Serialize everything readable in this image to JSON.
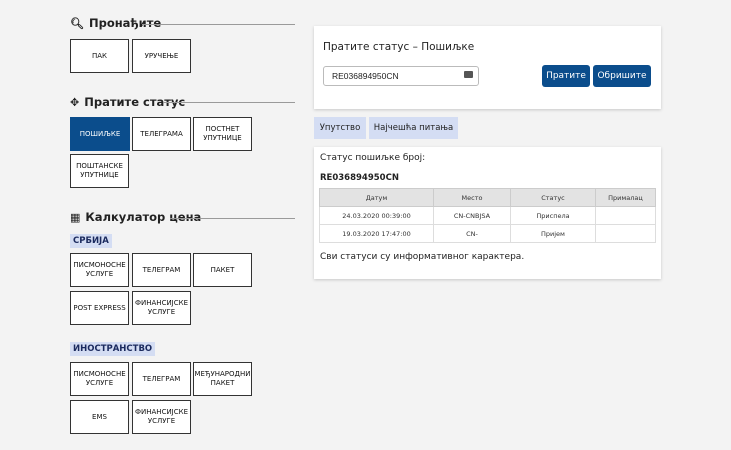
{
  "find": {
    "title": "Пронађите",
    "items": [
      "ПАК",
      "УРУЧЕЊЕ"
    ]
  },
  "status": {
    "title": "Пратите статус",
    "items": [
      "ПОШИЉКЕ",
      "ТЕЛЕГРАМА",
      "ПОСТНЕТ УПУТНИЦЕ",
      "ПОШТАНСКЕ УПУТНИЦЕ"
    ]
  },
  "calc": {
    "title": "Калкулатор цена",
    "serbia": {
      "label": "СРБИЈА",
      "items": [
        "ПИСМОНОСНЕ УСЛУГЕ",
        "ТЕЛЕГРАМ",
        "ПАКЕТ",
        "POST EXPRESS",
        "ФИНАНСИЈСКЕ УСЛУГЕ"
      ]
    },
    "abroad": {
      "label": "ИНОСТРАНСТВО",
      "items": [
        "ПИСМОНОСНЕ УСЛУГЕ",
        "ТЕЛЕГРАМ",
        "МЕЂУНАРОДНИ ПАКЕТ",
        "EMS",
        "ФИНАНСИЈСКЕ УСЛУГЕ"
      ]
    }
  },
  "tracking": {
    "title": "Пратите статус – Пошиљке",
    "input_value": "RE036894950CN",
    "track_button": "Пратите",
    "delete_button": "Обришите"
  },
  "tabs": [
    "Упутство",
    "Најчешћа питања"
  ],
  "result": {
    "label": "Статус пошиљке број:",
    "number": "RE036894950CN",
    "columns": [
      "Датум",
      "Место",
      "Статус",
      "Прималац"
    ],
    "rows": [
      [
        "24.03.2020 00:39:00",
        "CN-CNBJSA",
        "Приспела",
        ""
      ],
      [
        "19.03.2020 17:47:00",
        "CN-",
        "Пријем",
        ""
      ]
    ],
    "note": "Сви статуси су информативног карактера."
  },
  "colors": {
    "primary": "#0b4d8c",
    "tag_bg": "#d4ddf3"
  },
  "icons": {
    "find": "search-icon",
    "status": "crosshair-icon",
    "calc": "grid-icon"
  }
}
